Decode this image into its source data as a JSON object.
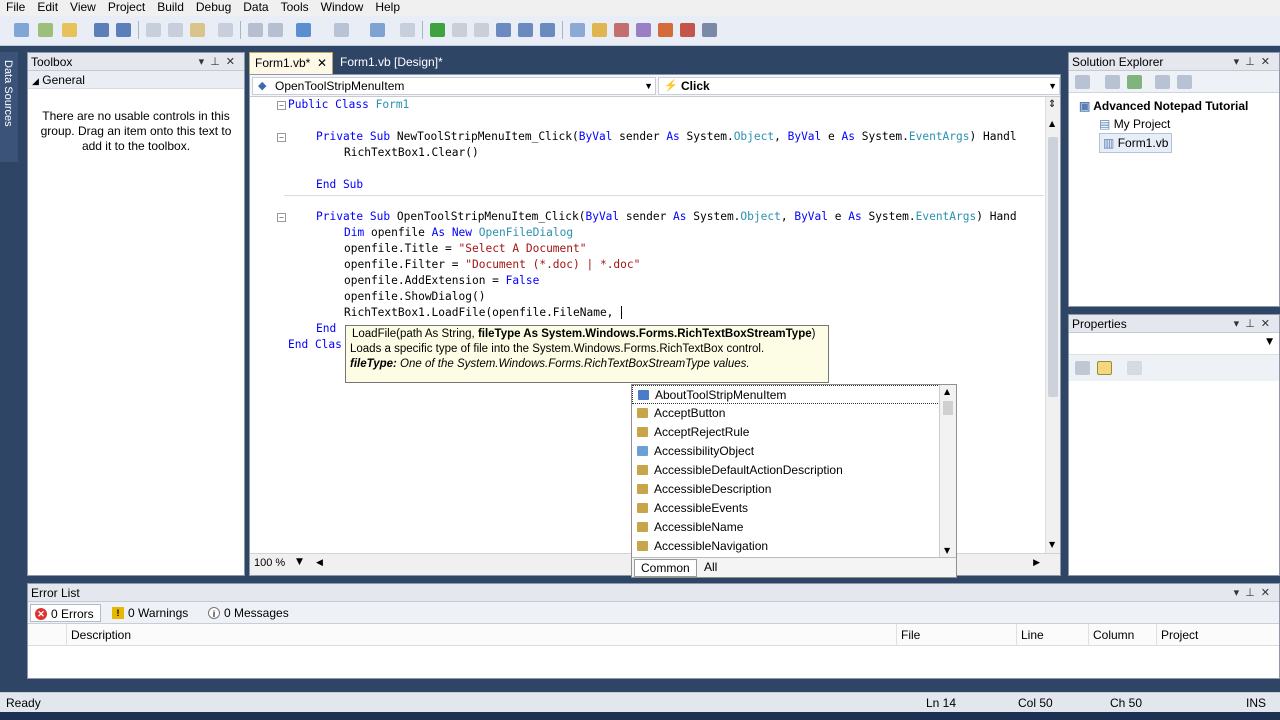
{
  "menu": [
    "File",
    "Edit",
    "View",
    "Project",
    "Build",
    "Debug",
    "Data",
    "Tools",
    "Window",
    "Help"
  ],
  "left_strip": {
    "label": "Data Sources"
  },
  "toolbox": {
    "title": "Toolbox",
    "group": "General",
    "message": "There are no usable controls in this group. Drag an item onto this text to add it to the toolbox."
  },
  "doc_tabs": [
    {
      "label": "Form1.vb*"
    },
    {
      "label": "Form1.vb [Design]*"
    }
  ],
  "navbar": {
    "object": "OpenToolStripMenuItem",
    "event": "Click"
  },
  "code": {
    "public_kw": "Public",
    "class_kw": "Class",
    "class_name": "Form1",
    "sub1": {
      "private_kw": "Private",
      "sub_kw": "Sub",
      "name": "NewToolStripMenuItem_Click(",
      "byval1": "ByVal",
      "p1": " sender ",
      "as1": "As",
      "ns1": " System.",
      "t1": "Object",
      "byval2": "ByVal",
      "p2": " e ",
      "as2": "As",
      "ns2": " System.",
      "t2": "EventArgs",
      "tail": ") Handl"
    },
    "line_clear": "RichTextBox1.Clear()",
    "end_sub": "End Sub",
    "sub2": {
      "private_kw": "Private",
      "sub_kw": "Sub",
      "name": "OpenToolStripMenuItem_Click(",
      "byval1": "ByVal",
      "p1": " sender ",
      "as1": "As",
      "ns1": " System.",
      "t1": "Object",
      "byval2": "ByVal",
      "p2": " e ",
      "as2": "As",
      "ns2": " System.",
      "t2": "EventArgs",
      "tail": ") Hand"
    },
    "dim_kw": "Dim",
    "dim_var": " openfile ",
    "dim_as": "As",
    "dim_new": "New",
    "dim_type": "OpenFileDialog",
    "title_lhs": "openfile.Title = ",
    "title_val": "\"Select A Document\"",
    "filter_lhs": "openfile.Filter = ",
    "filter_val": "\"Document (*.doc) | *.doc\"",
    "addext_lhs": "openfile.AddExtension = ",
    "addext_val": "False",
    "showdialog": "openfile.ShowDialog()",
    "loadfile": "RichTextBox1.LoadFile(openfile.FileName, ",
    "end_sub2": "End",
    "end_class": "End Clas"
  },
  "tooltip": {
    "sig_plain": "LoadFile(path As String, ",
    "sig_bold": "fileType As System.Windows.Forms.RichTextBoxStreamType",
    "sig_end": ")",
    "desc": "Loads a specific type of file into the System.Windows.Forms.RichTextBox control.",
    "param_name": "fileType:",
    "param_desc": " One of the System.Windows.Forms.RichTextBoxStreamType values."
  },
  "intellisense": {
    "items": [
      "AboutToolStripMenuItem",
      "AcceptButton",
      "AcceptRejectRule",
      "AccessibilityObject",
      "AccessibleDefaultActionDescription",
      "AccessibleDescription",
      "AccessibleEvents",
      "AccessibleName",
      "AccessibleNavigation"
    ],
    "tabs": [
      "Common",
      "All"
    ]
  },
  "editor": {
    "zoom": "100 %"
  },
  "solution_explorer": {
    "title": "Solution Explorer",
    "solution": "Advanced Notepad Tutorial",
    "items": [
      "My Project",
      "Form1.vb"
    ]
  },
  "properties": {
    "title": "Properties"
  },
  "error_list": {
    "title": "Error List",
    "tabs": [
      "0 Errors",
      "0 Warnings",
      "0 Messages"
    ],
    "columns": [
      "Description",
      "File",
      "Line",
      "Column",
      "Project"
    ]
  },
  "status": {
    "ready": "Ready",
    "ln": "Ln 14",
    "col": "Col 50",
    "ch": "Ch 50",
    "mode": "INS"
  },
  "colors": {
    "accent": "#2e4566",
    "keyword": "#0000ff",
    "type": "#2b91af",
    "string": "#a31515"
  }
}
